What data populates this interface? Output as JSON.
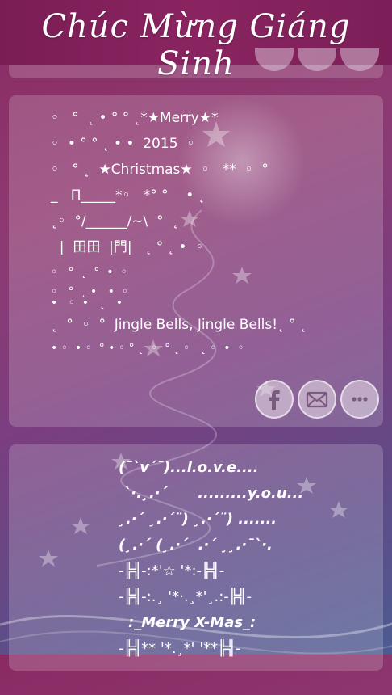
{
  "header": {
    "title": "Chúc Mừng Giáng Sinh"
  },
  "card1": {
    "lines": [
      "◦   °  ˛ • ° ° ˛*★Merry★*",
      "◦  • ° ° ˛ • •  2015  ◦",
      "◦   ° ˛  ★Christmas★  ◦   **  ◦  °",
      "_   Π_____*◦   *° °    • ˛",
      "˛◦  °/______/~\\  °  ˛",
      "  |  田田  |門|   ˛ ° ˛ •  ◦",
      "◦   °  ˛  °  •  ◦",
      "◦   °  ˛ •   •  ◦",
      "•   ◦  •   ˛   •",
      "˛  °  ◦  °  Jingle Bells, Jingle Bells!˛ ° ˛",
      "• ◦  • ◦  ° • ◦ ° ˛  ◦  ° ˛ ◦   ˛ ◦  •  ◦"
    ]
  },
  "card2": {
    "lines": [
      "(¯`v´¯)...l.o.v.e....",
      " `·.¸.·´      .........y.o.u...",
      "¸.·´ ¸.·´¨) ¸.·´¨) .......",
      "(¸.·´ (¸.·´  .·´ ¸¸.·¯`·.",
      "-╠╣-:*'☆ '*:-╠╣-",
      "-╠╣-:.¸ '*·.¸*'¸.:-╠╣-",
      ":_Merry X-Mas_:",
      "-╠╣** '*.¸*' '**╠╣-"
    ]
  },
  "share": {
    "facebook_icon": "facebook-icon",
    "mail_icon": "mail-icon",
    "more_icon": "more-icon"
  }
}
